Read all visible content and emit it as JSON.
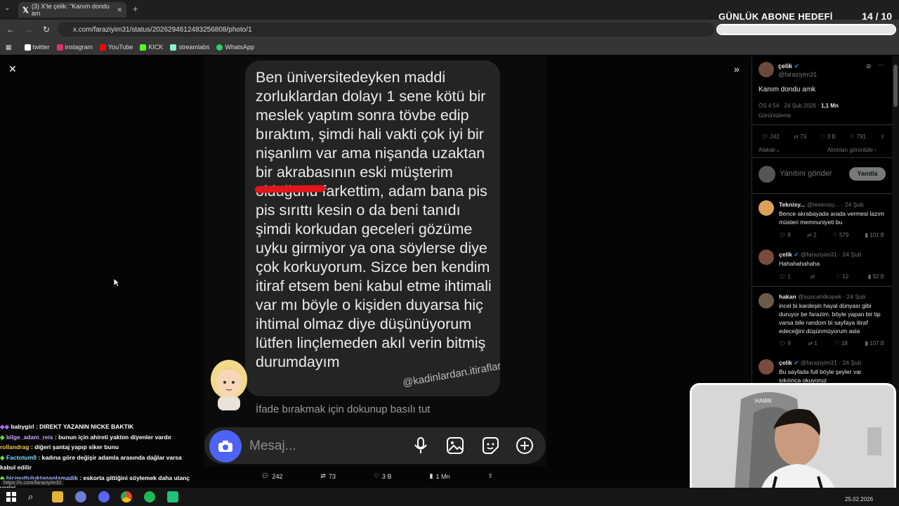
{
  "browser": {
    "tab_title": "(3) X'te çelik: \"Kanım dondu am",
    "url": "x.com/faraziyim31/status/2026294612483256808/photo/1",
    "bookmarks": [
      {
        "label": "twitter",
        "color": "#ffffff"
      },
      {
        "label": "instagram",
        "color": "#e1306c"
      },
      {
        "label": "YouTube",
        "color": "#ff0000"
      },
      {
        "label": "KICK",
        "color": "#53fc18"
      },
      {
        "label": "streamlabs",
        "color": "#80f5d2"
      },
      {
        "label": "WhatsApp",
        "color": "#25d366"
      }
    ],
    "status_url": "https://x.com/faraziyim31"
  },
  "overlay": {
    "goal_title": "GÜNLÜK ABONE HEDEFİ",
    "goal_count": "14  / 10",
    "goal_progress": 1.0
  },
  "photo": {
    "story_text": "Ben üniversitedeyken maddi zorluklardan dolayı 1 sene kötü bir meslek yaptım sonra tövbe edip bıraktım, şimdi hali vakti çok iyi bir nişanlım var ama nişanda uzaktan bir akrabasının eski müşterim olduğunu farkettim, adam bana pis pis sırıttı kesin o da beni tanıdı şimdi korkudan geceleri gözüme uyku girmiyor ya ona söylerse diye çok korkuyorum. Sizce ben kendim itiraf etsem beni kabul etme ihtimali var mı böyle o kişiden duyarsa hiç ihtimal olmaz diye düşünüyorum lütfen linçlemeden akıl verin bitmiş durumdayım",
    "watermark": "@kadinlardan.itiraflar",
    "react_hint": "İfade bırakmak için dokunup basılı tut",
    "message_placeholder": "Mesaj..."
  },
  "photo_stats": {
    "replies": "242",
    "reposts": "73",
    "likes": "3 B",
    "views": "1 Mn"
  },
  "post": {
    "author": "çelik",
    "handle": "@faraziyim31",
    "text": "Kanım dondu amk",
    "time": "ÖS 4:54 · 24 Şub 2026 · ",
    "views_count": "1,1 Mn",
    "views_label": "Görüntüleme",
    "replies": "242",
    "reposts": "73",
    "likes": "3 B",
    "bookmarks": "791",
    "alt_left": "Alakalı",
    "alt_right": "Alıntıları görüntüle",
    "reply_placeholder": "Yanıtını gönder",
    "reply_button": "Yanıtla"
  },
  "replies": [
    {
      "name": "Teknisy...",
      "handle": "@teeknisy...",
      "date": "· 24 Şub",
      "text": "Bence akrabayada arada vermesi lazım müsteri memnuniyeti bu",
      "stats": [
        "8",
        "2",
        "579",
        "101 B"
      ],
      "avatar": "#d9a15a"
    },
    {
      "name": "çelik",
      "handle": "@faraziyim31",
      "date": "· 24 Şub",
      "text": "Hahahahahaha",
      "stats": [
        "1",
        "",
        "12",
        "92 B"
      ],
      "avatar": "#7a4a3c"
    },
    {
      "name": "hakan",
      "handle": "@suscahilkopek",
      "date": "· 24 Şub",
      "text": "incel bi kardeşin hayal dünyası gibi duruyor be farazim. böyle yapan bir tip varsa bile random bi sayfaya itiraf edeceğini düşünmüyorum asla",
      "stats": [
        "9",
        "1",
        "18",
        "107 B"
      ],
      "avatar": "#6b5a4a"
    },
    {
      "name": "çelik",
      "handle": "@faraziyim31",
      "date": "· 24 Şub",
      "text": "Bu sayfada full böyle şeyler var sıkılınca okuyoruz",
      "stats": [],
      "avatar": "#7a4a3c"
    }
  ],
  "chat": [
    {
      "user": "babygirl",
      "msg": ": DIREKT YAZANIN NICKE BAKTIK",
      "badge": "◆◆",
      "badge_color": "#b26cf0"
    },
    {
      "user": "bilge_adam_reis",
      "msg": ": bunun için ahireti yaktım diyenler vardır",
      "badge": "◆",
      "badge_color": "#6bd84a"
    },
    {
      "user": "rollandrag",
      "msg": ": diğeri şantaj yapıp siker bunu",
      "badge": "",
      "badge_color": "#6bd84a"
    },
    {
      "user": "Factotum9",
      "msg": ": kadına göre değişir adamla arasında dağlar varsa kabul edilir",
      "badge": "◆",
      "badge_color": "#6bd84a"
    },
    {
      "user": "hicmutluluktanaglamadik",
      "msg": ": eskorta gittiğini söylemek daha utanç verici",
      "badge": "◆",
      "badge_color": "#6bd84a"
    }
  ],
  "taskbar": {
    "date": "25.02.2026"
  },
  "webcam": {
    "chair_brand": "HAWK"
  }
}
